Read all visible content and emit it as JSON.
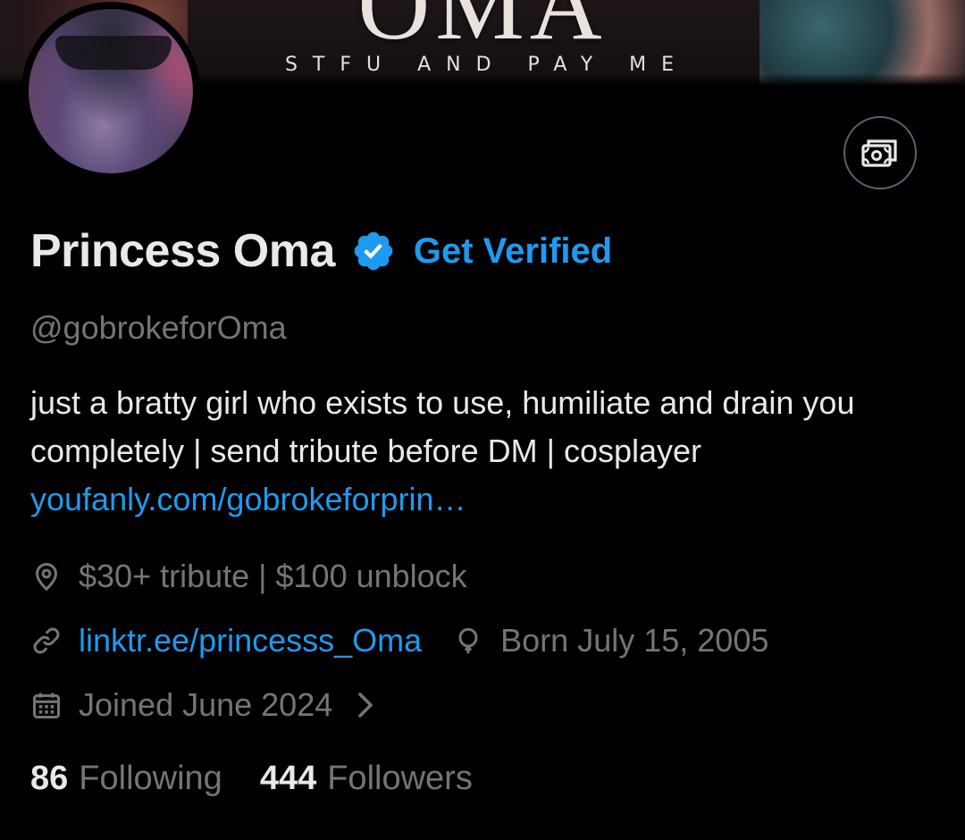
{
  "banner": {
    "big_text": "OMA",
    "tagline": "STFU AND PAY ME"
  },
  "profile": {
    "display_name": "Princess Oma",
    "get_verified_label": "Get Verified",
    "handle": "@gobrokeforOma",
    "bio_text": "just a bratty girl who exists to use, humiliate and drain you completely | send tribute before DM | cosplayer ",
    "bio_link": "youfanly.com/gobrokeforprin…",
    "location": "$30+ tribute | $100 unblock",
    "website": "linktr.ee/princesss_Oma",
    "birthday": "Born July 15, 2005",
    "joined": "Joined June 2024"
  },
  "stats": {
    "following_count": "86",
    "following_label": "Following",
    "followers_count": "444",
    "followers_label": "Followers"
  },
  "icons": {
    "tip": "money-icon",
    "verified": "verified-badge-icon",
    "location": "location-pin-icon",
    "link": "link-icon",
    "birthday": "balloon-icon",
    "calendar": "calendar-icon",
    "chevron": "chevron-right-icon"
  },
  "colors": {
    "accent": "#1d9bf0",
    "secondary_text": "#71767b",
    "primary_text": "#e7e9ea",
    "background": "#000000"
  }
}
